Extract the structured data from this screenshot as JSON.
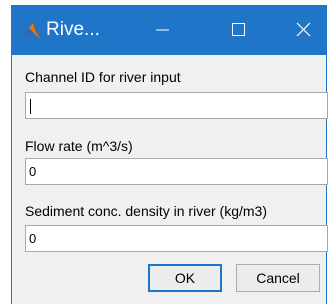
{
  "window": {
    "title": "Rive...",
    "accent_color": "#1f75c8",
    "app_icon": "matlab-icon",
    "controls": {
      "minimize_icon": "minimize-icon",
      "maximize_icon": "maximize-icon",
      "close_icon": "close-icon"
    }
  },
  "form": {
    "channel": {
      "label": "Channel ID for river input",
      "value": ""
    },
    "flow": {
      "label": "Flow rate (m^3/s)",
      "value": "0"
    },
    "sediment": {
      "label": "Sediment conc. density in river (kg/m3)",
      "value": "0"
    }
  },
  "buttons": {
    "ok_label": "OK",
    "cancel_label": "Cancel"
  }
}
